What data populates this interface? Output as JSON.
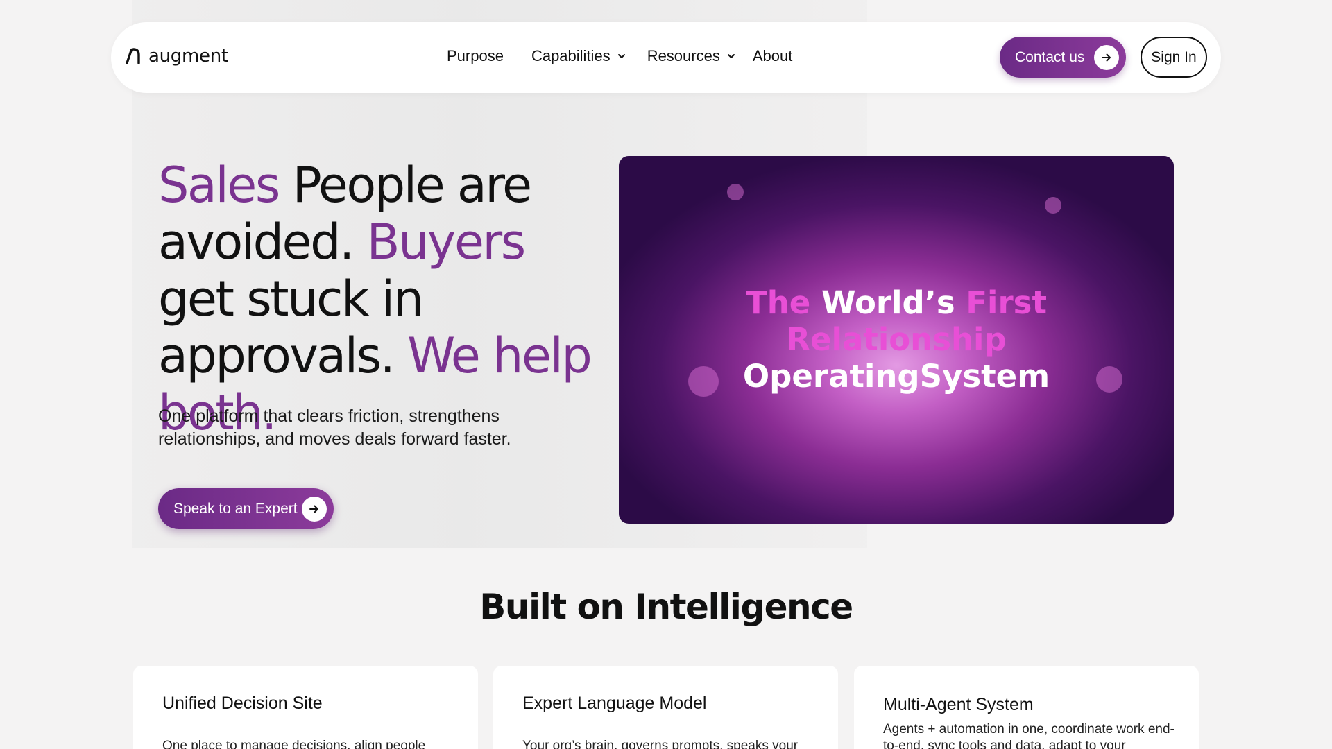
{
  "nav": {
    "logo_text": "augment",
    "links": [
      {
        "label": "Purpose"
      },
      {
        "label": "Capabilities"
      },
      {
        "label": "Resources"
      },
      {
        "label": "About"
      }
    ],
    "contact_label": "Contact us",
    "signin_label": "Sign In"
  },
  "hero": {
    "title_parts": [
      "Sales",
      " People are avoided. ",
      "Buyers",
      " get stuck in approvals. ",
      "We help both."
    ],
    "subtitle": "One platform that clears friction, strengthens relationships, and moves deals forward faster.",
    "cta_label": "Speak to an Expert",
    "media": {
      "line1_a": "The ",
      "line1_b": "World’s ",
      "line1_c": "First",
      "line2": "Relationship",
      "line3": "OperatingSystem"
    }
  },
  "section": {
    "title": "Built on Intelligence",
    "cards": [
      {
        "title": "Unified Decision Site",
        "desc": "One place to manage decisions, align people"
      },
      {
        "title": "Expert Language Model",
        "desc": "Your org’s brain, governs prompts, speaks your"
      },
      {
        "title": "Multi-Agent System",
        "desc": "Agents + automation in one, coordinate work end-to-end, sync tools and data, adapt to your"
      }
    ]
  },
  "colors": {
    "accent_purple": "#7a3390",
    "media_pink": "#e84fd6"
  },
  "icons": [
    "logo-mark-icon",
    "chevron-down-icon",
    "arrow-right-icon"
  ]
}
